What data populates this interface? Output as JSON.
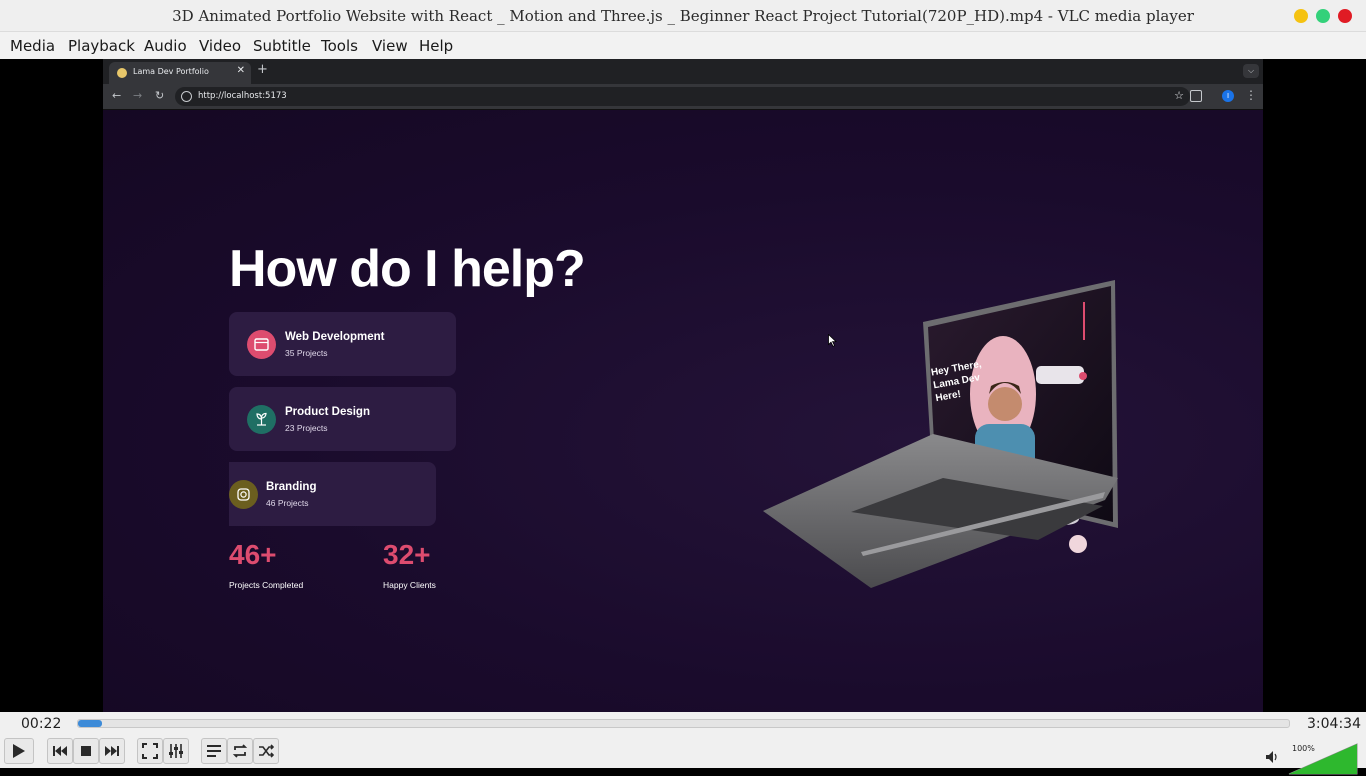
{
  "window": {
    "title": "3D Animated Portfolio Website with React _ Motion and Three.js _ Beginner React Project Tutorial(720P_HD).mp4 - VLC media player"
  },
  "menu": [
    "Media",
    "Playback",
    "Audio",
    "Video",
    "Subtitle",
    "Tools",
    "View",
    "Help"
  ],
  "browser": {
    "tab_title": "Lama Dev Portfolio",
    "tab_close": "✕",
    "new_tab": "+",
    "url": "http://localhost:5173",
    "profile_initial": "I"
  },
  "page": {
    "heading": "How do I help?",
    "services": [
      {
        "title": "Web Development",
        "subtitle": "35 Projects",
        "icon": "browser-icon",
        "color": "#dd4c6f"
      },
      {
        "title": "Product Design",
        "subtitle": "23 Projects",
        "icon": "plant-icon",
        "color": "#1f6f64"
      },
      {
        "title": "Branding",
        "subtitle": "46 Projects",
        "icon": "camera-icon",
        "color": "#6b5e1f"
      }
    ],
    "stats": [
      {
        "value": "46+",
        "label": "Projects Completed"
      },
      {
        "value": "32+",
        "label": "Happy Clients"
      }
    ],
    "laptop_greeting": [
      "Hey There,",
      "Lama Dev",
      "Here!"
    ]
  },
  "player": {
    "elapsed": "00:22",
    "total": "3:04:34",
    "progress": 0.002,
    "volume_label": "100%",
    "volume": 1.0,
    "accent": "#3d8bd8",
    "volume_color": "#2eb82e"
  }
}
